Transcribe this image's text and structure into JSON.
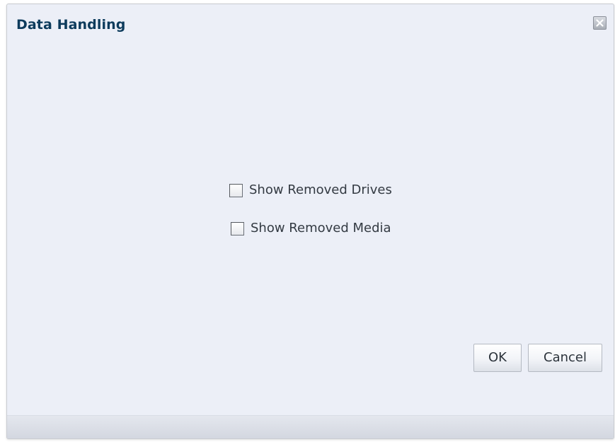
{
  "dialog": {
    "title": "Data Handling",
    "close_icon": "close-icon"
  },
  "options": [
    {
      "label": "Show Removed Drives",
      "checked": false
    },
    {
      "label": "Show Removed Media",
      "checked": false
    }
  ],
  "buttons": {
    "ok_label": "OK",
    "cancel_label": "Cancel"
  },
  "colors": {
    "title": "#0d3b5c",
    "dialog_background": "#eceff7"
  }
}
